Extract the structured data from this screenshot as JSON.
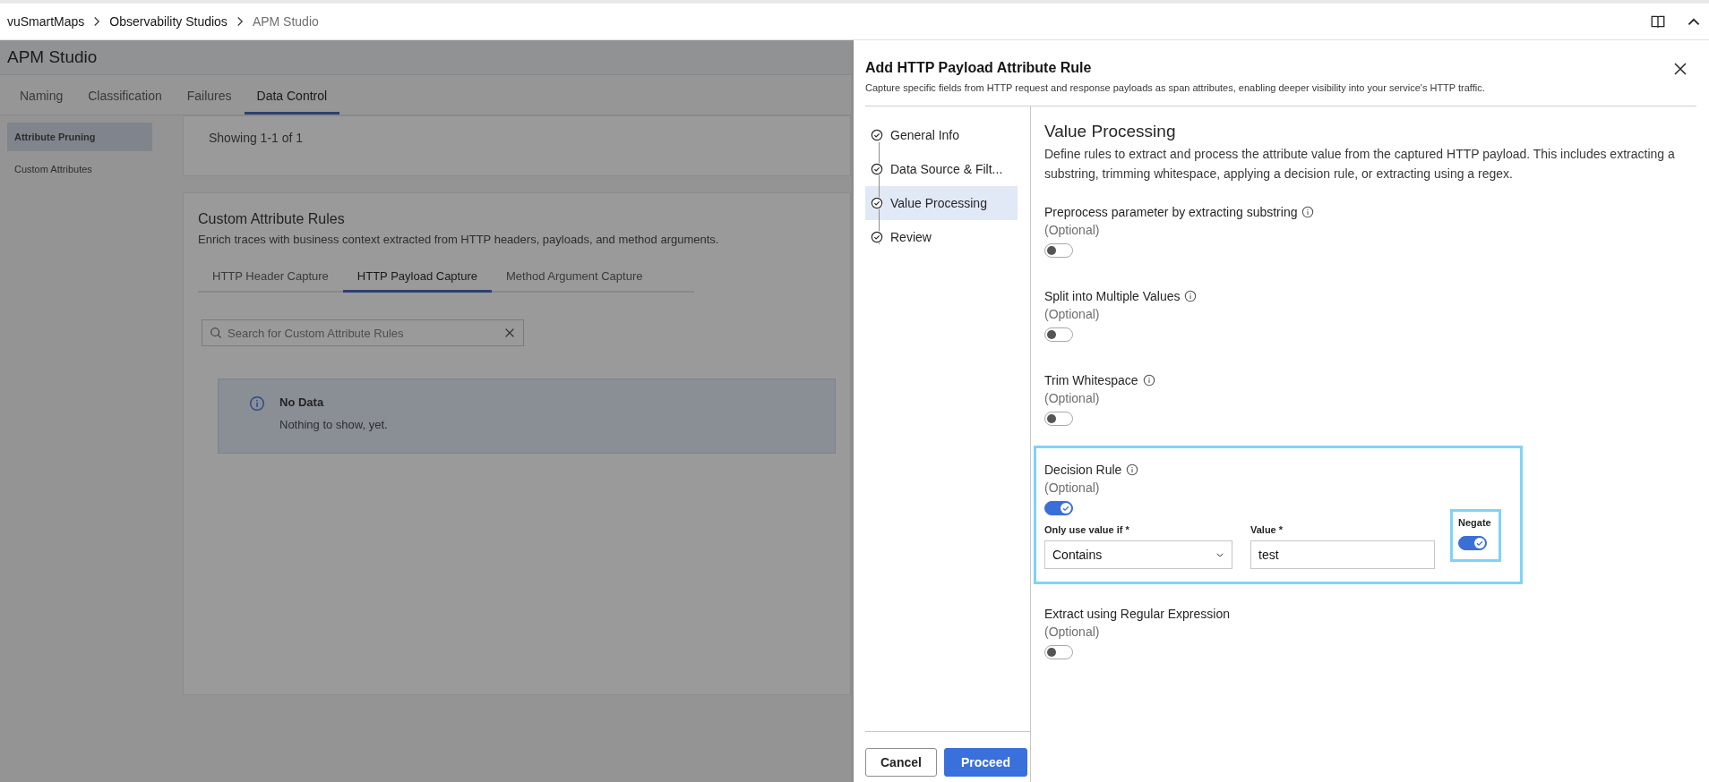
{
  "breadcrumb": [
    {
      "label": "vuSmartMaps",
      "current": false
    },
    {
      "label": "Observability Studios",
      "current": false
    },
    {
      "label": "APM Studio",
      "current": true
    }
  ],
  "page": {
    "title": "APM Studio",
    "tabs": [
      {
        "label": "Naming",
        "selected": false
      },
      {
        "label": "Classification",
        "selected": false
      },
      {
        "label": "Failures",
        "selected": false
      },
      {
        "label": "Data Control",
        "selected": true
      }
    ],
    "sidebar": {
      "items": [
        {
          "label": "Attribute Pruning",
          "selected": true
        },
        {
          "label": "Custom Attributes",
          "selected": false
        }
      ]
    },
    "summary": "Showing 1-1 of 1",
    "rules_card": {
      "title": "Custom Attribute Rules",
      "description": "Enrich traces with business context extracted from HTTP headers, payloads, and method arguments.",
      "tabs": [
        {
          "label": "HTTP Header Capture",
          "selected": false
        },
        {
          "label": "HTTP Payload Capture",
          "selected": true
        },
        {
          "label": "Method Argument Capture",
          "selected": false
        }
      ],
      "search": {
        "placeholder": "Search for Custom Attribute Rules"
      },
      "empty_state": {
        "title": "No Data",
        "message": "Nothing to show, yet."
      }
    }
  },
  "drawer": {
    "title": "Add HTTP Payload Attribute Rule",
    "description": "Capture specific fields from HTTP request and response payloads as span attributes, enabling deeper visibility into your service's HTTP traffic.",
    "steps": [
      {
        "label": "General Info",
        "selected": false
      },
      {
        "label": "Data Source & Filt...",
        "selected": false
      },
      {
        "label": "Value Processing",
        "selected": true
      },
      {
        "label": "Review",
        "selected": false
      }
    ],
    "section": {
      "title": "Value Processing",
      "description": "Define rules to extract and process the attribute value from the captured HTTP payload. This includes extracting a substring, trimming whitespace, applying a decision rule, or extracting using a regex.",
      "options": [
        {
          "label": "Preprocess parameter by extracting substring",
          "info": true,
          "note": "(Optional)",
          "on": false,
          "highlighted": false
        },
        {
          "label": "Split into Multiple Values",
          "info": true,
          "note": "(Optional)",
          "on": false,
          "highlighted": false
        },
        {
          "label": "Trim Whitespace",
          "info": true,
          "note": "(Optional)",
          "on": false,
          "highlighted": false
        },
        {
          "label": "Decision Rule",
          "info": true,
          "note": "(Optional)",
          "on": true,
          "highlighted": true,
          "fields": {
            "condition": {
              "label": "Only use value if *",
              "value": "Contains"
            },
            "value": {
              "label": "Value *",
              "value": "test"
            },
            "negate": {
              "label": "Negate",
              "on": true,
              "highlighted": true
            }
          }
        },
        {
          "label": "Extract using Regular Expression",
          "info": false,
          "note": "(Optional)",
          "on": false,
          "highlighted": false
        }
      ]
    },
    "buttons": [
      {
        "label": "Cancel",
        "kind": "secondary"
      },
      {
        "label": "Proceed",
        "kind": "primary"
      }
    ]
  }
}
